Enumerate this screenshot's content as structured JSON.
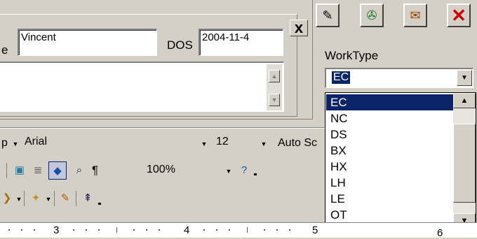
{
  "form": {
    "name_label_partial": "e",
    "name_value": "Vincent",
    "dos_label": "DOS",
    "dos_value": "2004-11-4",
    "close_glyph": "x"
  },
  "toolbar_right": {
    "buttons": [
      "notes-icon",
      "save-icon",
      "mail-icon",
      "close-red-icon"
    ]
  },
  "worktype": {
    "label": "WorkType",
    "selected": "EC",
    "options": [
      "EC",
      "NC",
      "DS",
      "BX",
      "HX",
      "LH",
      "LE",
      "OT"
    ]
  },
  "format_toolbar": {
    "style_partial": "p",
    "font": "Arial",
    "size": "12",
    "auto_partial": "Auto Sc"
  },
  "standard_toolbar": {
    "zoom": "100%",
    "pilcrow": "¶"
  },
  "ruler": {
    "labels": [
      "3",
      "4",
      "5",
      "6"
    ]
  },
  "colors": {
    "face": "#d4d0c8",
    "highlight": "#0a246a",
    "close_red": "#d00000"
  }
}
